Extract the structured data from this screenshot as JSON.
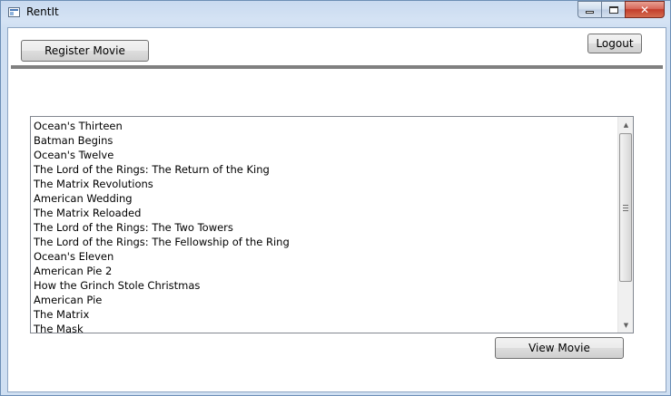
{
  "window": {
    "title": "RentIt",
    "minimize_icon": "minimize-icon",
    "maximize_icon": "maximize-icon",
    "close_label": "✕"
  },
  "toolbar": {
    "register_label": "Register Movie",
    "logout_label": "Logout"
  },
  "movies": {
    "items": [
      "Ocean's Thirteen",
      "Batman Begins",
      "Ocean's Twelve",
      "The Lord of the Rings: The Return of the King",
      "The Matrix Revolutions",
      "American Wedding",
      "The Matrix Reloaded",
      "The Lord of the Rings: The Two Towers",
      "The Lord of the Rings: The Fellowship of the Ring",
      "Ocean's Eleven",
      "American Pie 2",
      "How the Grinch Stole Christmas",
      "American Pie",
      "The Matrix",
      "The Mask"
    ],
    "scroll_up_glyph": "▲",
    "scroll_down_glyph": "▼"
  },
  "actions": {
    "view_label": "View Movie"
  }
}
